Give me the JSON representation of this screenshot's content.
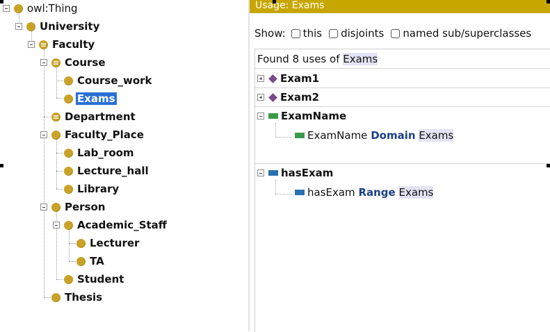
{
  "tree": {
    "nodes": [
      {
        "label": "owl:Thing"
      },
      {
        "label": "University"
      },
      {
        "label": "Faculty"
      },
      {
        "label": "Course"
      },
      {
        "label": "Course_work"
      },
      {
        "label": "Exams"
      },
      {
        "label": "Department"
      },
      {
        "label": "Faculty_Place"
      },
      {
        "label": "Lab_room"
      },
      {
        "label": "Lecture_hall"
      },
      {
        "label": "Library"
      },
      {
        "label": "Person"
      },
      {
        "label": "Academic_Staff"
      },
      {
        "label": "Lecturer"
      },
      {
        "label": "TA"
      },
      {
        "label": "Student"
      },
      {
        "label": "Thesis"
      }
    ]
  },
  "usage": {
    "header": "Usage: Exams",
    "show_label": "Show:",
    "options": [
      "this",
      "disjoints",
      "named sub/superclasses"
    ],
    "found_prefix": "Found 8 uses of ",
    "found_term": "Exams",
    "items": [
      {
        "label": "Exam1"
      },
      {
        "label": "Exam2"
      },
      {
        "label": "ExamName",
        "detail": {
          "subject": "ExamName",
          "keyword": "Domain",
          "object": "Exams"
        }
      },
      {
        "label": "hasExam",
        "detail": {
          "subject": "hasExam",
          "keyword": "Range",
          "object": "Exams"
        }
      }
    ]
  },
  "colors": {
    "class_icon": "#c9a227",
    "header_bar": "#c7a600",
    "selection": "#2a6fd6",
    "individual_icon": "#7a4a8a",
    "data_property_icon": "#3a9a4a",
    "object_property_icon": "#2a70b0",
    "keyword": "#1b3f86"
  }
}
